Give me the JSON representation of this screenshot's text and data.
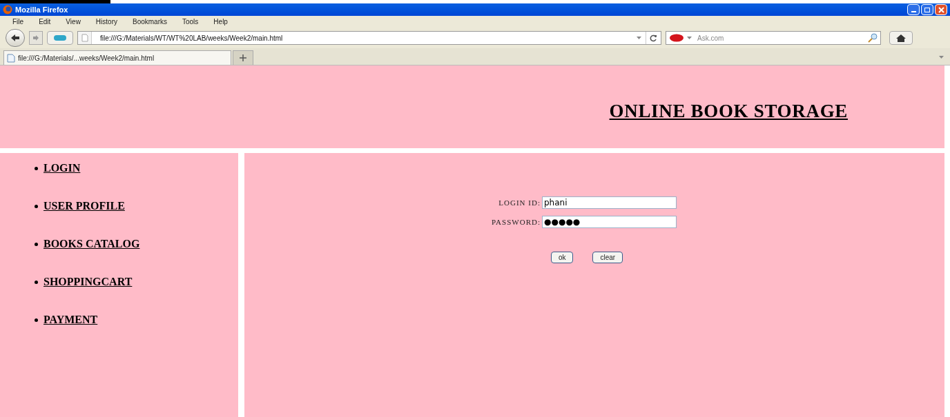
{
  "window": {
    "title": "Mozilla Firefox"
  },
  "menu": [
    "File",
    "Edit",
    "View",
    "History",
    "Bookmarks",
    "Tools",
    "Help"
  ],
  "address": {
    "value": "file:///G:/Materials/WT/WT%20LAB/weeks/Week2/main.html"
  },
  "search": {
    "placeholder": "Ask.com"
  },
  "tabs": [
    {
      "label": "file:///G:/Materials/...weeks/Week2/main.html",
      "selected": true
    }
  ],
  "page": {
    "heading": "ONLINE BOOK STORAGE",
    "nav": [
      "LOGIN",
      "USER PROFILE",
      "BOOKS CATALOG",
      "SHOPPINGCART",
      "PAYMENT"
    ],
    "form": {
      "fields": [
        {
          "label": "LOGIN ID:",
          "value": "phani"
        },
        {
          "label": "PASSWORD:",
          "value": "●●●●●"
        }
      ],
      "buttons": [
        "ok",
        "clear"
      ]
    }
  }
}
